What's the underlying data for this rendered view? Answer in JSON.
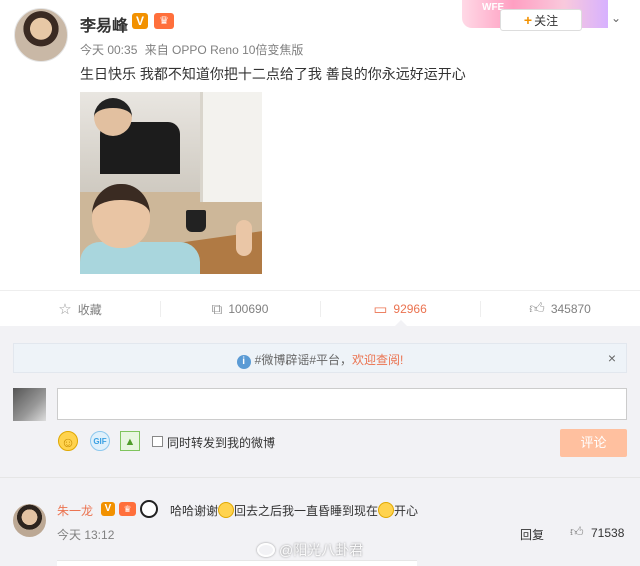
{
  "post": {
    "author": "李易峰",
    "verified_badge": "V",
    "member_badge": "♛",
    "time": "今天 00:35",
    "source": "来自 OPPO Reno 10倍变焦版",
    "text": "生日快乐 我都不知道你把十二点给了我 善良的你永远好运开心",
    "follow_label": "关注",
    "follow_plus": "+",
    "menu_icon": "chevron-down-icon",
    "banner_text": "WFE"
  },
  "actions": {
    "favorite": {
      "icon": "star-icon",
      "label": "收藏"
    },
    "repost": {
      "icon": "repost-icon",
      "label": "100690"
    },
    "comment": {
      "icon": "comment-icon",
      "label": "92966",
      "active_color": "#eb7350"
    },
    "like": {
      "icon": "thumbs-up-icon",
      "label": "345870"
    }
  },
  "comment_box": {
    "notice_prefix": "#微博辟谣#平台，",
    "notice_link": "欢迎查阅!",
    "notice_close": "×",
    "input_value": "",
    "repost_label": "同时转发到我的微博",
    "repost_checked": false,
    "submit_label": "评论"
  },
  "comments": [
    {
      "author": "朱一龙",
      "text_before": "哈哈谢谢",
      "text_middle": "回去之后我一直昏睡到现在",
      "text_after": "开心",
      "time": "今天 13:12",
      "reply_label": "回复",
      "like_count": "71538"
    }
  ],
  "watermark": "@阳光八卦君",
  "colors": {
    "accent": "#eb7350",
    "badge_orange": "#f29100",
    "background": "#f2f2f5",
    "submit_disabled": "#ffc09f"
  }
}
